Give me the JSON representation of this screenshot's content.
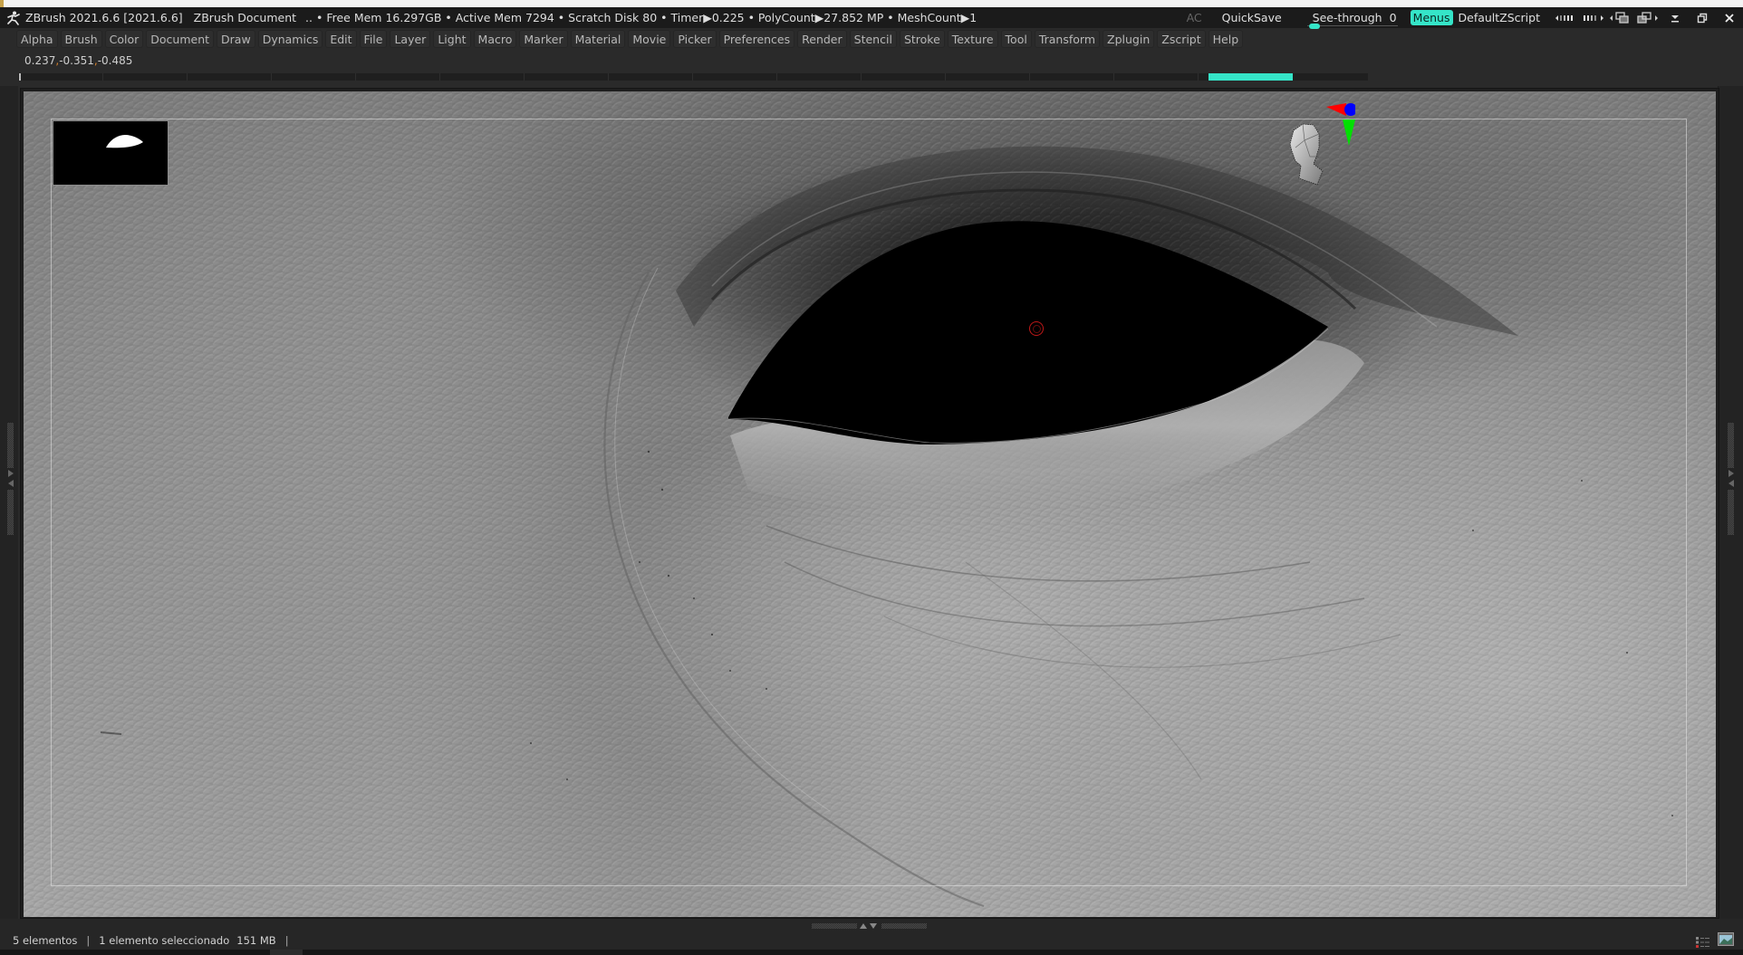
{
  "titlebar": {
    "app_title": "ZBrush 2021.6.6 [2021.6.6]",
    "document": "ZBrush Document",
    "stats": ".. • Free Mem 16.297GB • Active Mem 7294 • Scratch Disk 80 •  Timer▶0.225 • PolyCount▶27.852 MP  • MeshCount▶1",
    "ac": "AC",
    "quicksave": "QuickSave",
    "see_through_label": "See-through",
    "see_through_value": "0",
    "menus": "Menus",
    "default_zscript": "DefaultZScript",
    "icons": [
      "ui-shrink-icon",
      "ui-expand-icon",
      "layout-prev-icon",
      "layout-next-icon",
      "minimize-icon",
      "restore-icon",
      "close-icon"
    ]
  },
  "menubar": {
    "items": [
      "Alpha",
      "Brush",
      "Color",
      "Document",
      "Draw",
      "Dynamics",
      "Edit",
      "File",
      "Layer",
      "Light",
      "Macro",
      "Marker",
      "Material",
      "Movie",
      "Picker",
      "Preferences",
      "Render",
      "Stencil",
      "Stroke",
      "Texture",
      "Tool",
      "Transform",
      "Zplugin",
      "Zscript",
      "Help"
    ]
  },
  "coords": {
    "x": "0.237",
    "y": "-0.351",
    "z": "-0.485",
    "separator": ","
  },
  "progress": {
    "segment_start_fraction": 0.882,
    "segment_end_fraction": 0.944,
    "color": "#35e5c8"
  },
  "viewport": {
    "subject": "sculpted eye close-up",
    "navigator_icon": "navigator-thumbnail",
    "gizmo": {
      "x_color": "#ff0000",
      "y_color": "#00e000",
      "z_color": "#0000ff"
    },
    "cursor_color": "#c01818"
  },
  "status": {
    "items_count": "5 elementos",
    "selected": "1 elemento seleccionado",
    "size": "151 MB",
    "separator": "|"
  },
  "colors": {
    "accent": "#35e5c8",
    "background": "#2a2a2a",
    "titlebar": "#1b1b1b"
  }
}
